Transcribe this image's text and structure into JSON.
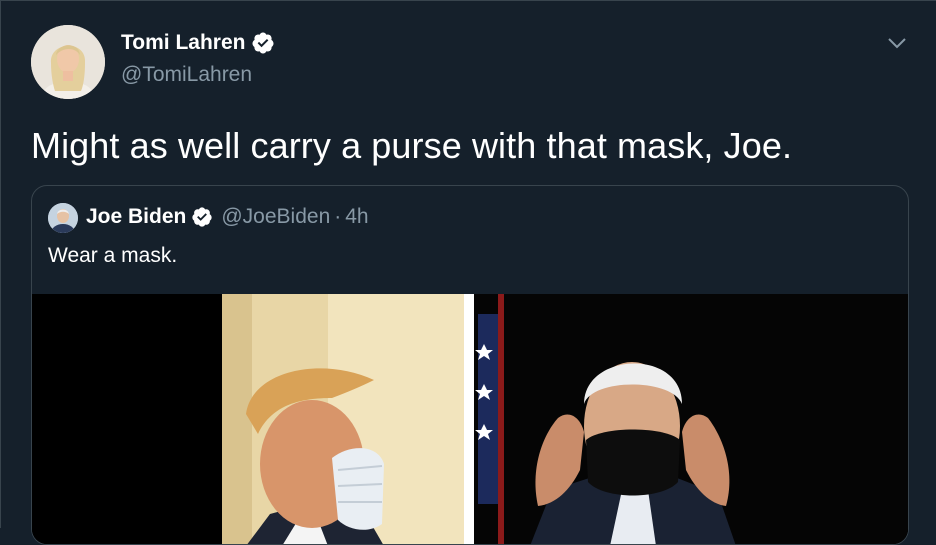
{
  "tweet": {
    "author": {
      "display_name": "Tomi Lahren",
      "handle": "@TomiLahren",
      "verified": true
    },
    "text": "Might as well carry a purse with that mask, Joe.",
    "quoted": {
      "author": {
        "display_name": "Joe Biden",
        "handle": "@JoeBiden",
        "verified": true
      },
      "separator": "·",
      "time": "4h",
      "text": "Wear a mask."
    }
  },
  "colors": {
    "background": "#15202b",
    "border": "#38444d",
    "secondary_text": "#8899a6",
    "primary_text": "#ffffff"
  },
  "icons": {
    "verified": "verified-badge-icon",
    "menu": "chevron-down-icon"
  }
}
